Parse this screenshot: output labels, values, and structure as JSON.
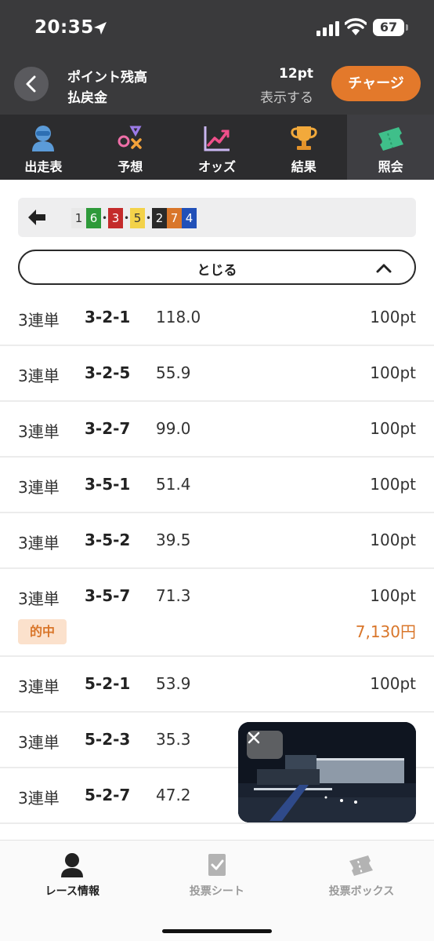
{
  "status": {
    "time": "20:35",
    "battery": "67"
  },
  "header": {
    "points_label": "ポイント残高",
    "refund_label": "払戻金",
    "points_value": "12pt",
    "show_label": "表示する",
    "charge_label": "チャージ"
  },
  "tabs": [
    {
      "label": "出走表",
      "icon": "racer-icon",
      "active": false
    },
    {
      "label": "予想",
      "icon": "prediction-icon",
      "active": false
    },
    {
      "label": "オッズ",
      "icon": "odds-chart-icon",
      "active": false
    },
    {
      "label": "結果",
      "icon": "trophy-icon",
      "active": false
    },
    {
      "label": "照会",
      "icon": "ticket-icon",
      "active": true
    }
  ],
  "result": {
    "chips": [
      {
        "text": "1",
        "bg": "#e8e8e8",
        "fg": "#333333"
      },
      {
        "text": "6",
        "bg": "#2e9a3a",
        "fg": "#ffffff"
      },
      {
        "text": "3",
        "bg": "#c42b2b",
        "fg": "#ffffff"
      },
      {
        "text": "5",
        "bg": "#f3d24a",
        "fg": "#333333"
      },
      {
        "text": "2",
        "bg": "#2a2a2a",
        "fg": "#ffffff"
      },
      {
        "text": "7",
        "bg": "#d9762a",
        "fg": "#ffffff"
      },
      {
        "text": "4",
        "bg": "#2150b8",
        "fg": "#ffffff"
      }
    ]
  },
  "close_label": "とじる",
  "bets": [
    {
      "type": "3連単",
      "combo": "3-2-1",
      "odds": "118.0",
      "amount": "100pt"
    },
    {
      "type": "3連単",
      "combo": "3-2-5",
      "odds": "55.9",
      "amount": "100pt"
    },
    {
      "type": "3連単",
      "combo": "3-2-7",
      "odds": "99.0",
      "amount": "100pt"
    },
    {
      "type": "3連単",
      "combo": "3-5-1",
      "odds": "51.4",
      "amount": "100pt"
    },
    {
      "type": "3連単",
      "combo": "3-5-2",
      "odds": "39.5",
      "amount": "100pt"
    },
    {
      "type": "3連単",
      "combo": "3-5-7",
      "odds": "71.3",
      "amount": "100pt",
      "hit_label": "的中",
      "payout": "7,130円"
    },
    {
      "type": "3連単",
      "combo": "5-2-1",
      "odds": "53.9",
      "amount": "100pt"
    },
    {
      "type": "3連単",
      "combo": "5-2-3",
      "odds": "35.3",
      "amount": ""
    },
    {
      "type": "3連単",
      "combo": "5-2-7",
      "odds": "47.2",
      "amount": ""
    }
  ],
  "bottom_nav": [
    {
      "label": "レース情報",
      "icon": "racer-icon",
      "active": true
    },
    {
      "label": "投票シート",
      "icon": "vote-sheet-icon",
      "active": false
    },
    {
      "label": "投票ボックス",
      "icon": "vote-box-icon",
      "active": false
    }
  ],
  "colors": {
    "accent": "#e3792b",
    "header_bg": "#3a3a3c",
    "hit": "#d9762a"
  }
}
